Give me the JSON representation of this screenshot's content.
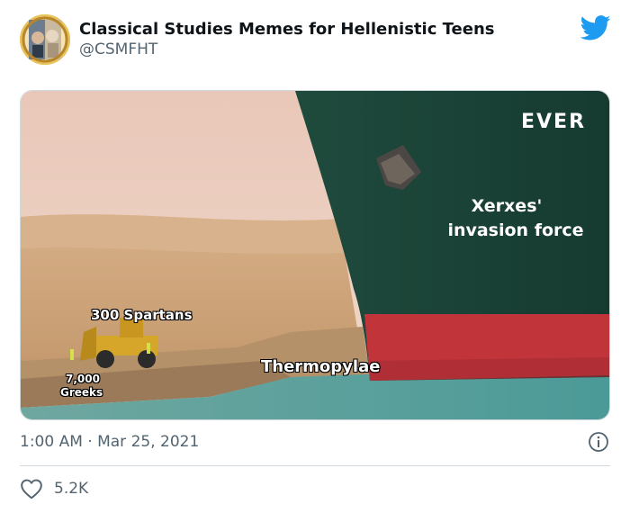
{
  "tweet": {
    "display_name": "Classical Studies Memes for Hellenistic Teens",
    "handle": "@CSMFHT",
    "timestamp": "1:00 AM · Mar 25, 2021",
    "like_count": "5.2K",
    "icons": {
      "brand": "twitter-bird-icon",
      "info": "info-icon",
      "like": "heart-icon"
    },
    "colors": {
      "brand_blue": "#1d9bf0",
      "secondary_text": "#536471",
      "divider": "#cfd9de"
    }
  },
  "meme": {
    "ship_name": "EVER",
    "label_ship_line1": "Xerxes'",
    "label_ship_line2": "invasion force",
    "label_loader": "300 Spartans",
    "label_workers_line1": "7,000",
    "label_workers_line2": "Greeks",
    "label_bank": "Thermopylae"
  }
}
